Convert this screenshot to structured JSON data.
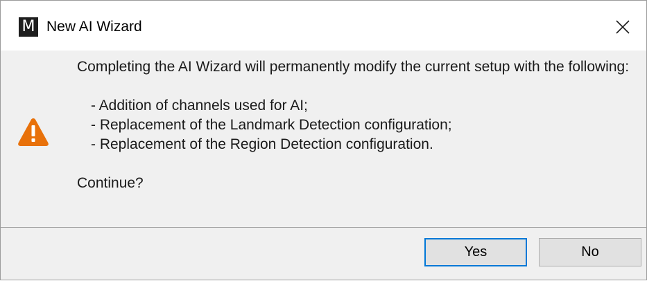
{
  "window": {
    "title": "New AI Wizard",
    "app_icon_letter": "M",
    "icon": "app-logo-icon"
  },
  "message": {
    "intro": "Completing the AI Wizard will permanently modify the current setup with the following:",
    "items": [
      "- Addition of channels used for AI;",
      "- Replacement of the Landmark Detection configuration;",
      "- Replacement of the Region Detection configuration."
    ],
    "question": "Continue?",
    "icon": "warning-icon",
    "icon_color": "#e8710a"
  },
  "buttons": {
    "yes_label": "Yes",
    "no_label": "No",
    "default": "yes",
    "accent_color": "#0078d7"
  }
}
